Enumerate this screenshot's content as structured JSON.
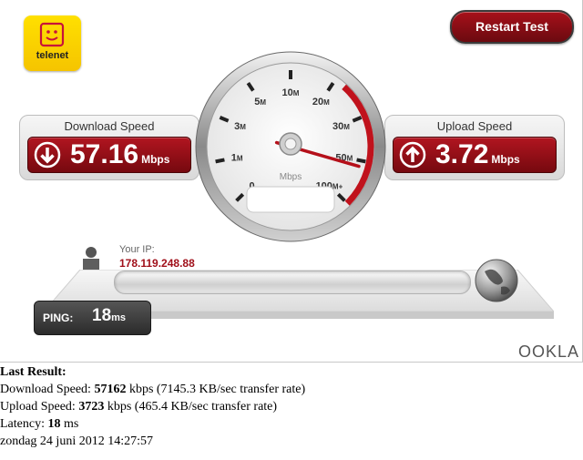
{
  "logo": {
    "text": "telenet",
    "icon": "smiley-face-icon"
  },
  "restart_button": "Restart Test",
  "download": {
    "title": "Download Speed",
    "value": "57.16",
    "unit": "Mbps",
    "icon": "arrow-down-icon"
  },
  "upload": {
    "title": "Upload Speed",
    "value": "3.72",
    "unit": "Mbps",
    "icon": "arrow-up-icon"
  },
  "gauge": {
    "unit_label": "Mbps",
    "ticks": [
      {
        "n": "0",
        "s": ""
      },
      {
        "n": "1",
        "s": "M"
      },
      {
        "n": "3",
        "s": "M"
      },
      {
        "n": "5",
        "s": "M"
      },
      {
        "n": "10",
        "s": "M"
      },
      {
        "n": "20",
        "s": "M"
      },
      {
        "n": "30",
        "s": "M"
      },
      {
        "n": "50",
        "s": "M"
      },
      {
        "n": "100",
        "s": "M+"
      }
    ],
    "needle_value": 57.16,
    "accent": "#c0121c"
  },
  "ip": {
    "label": "Your IP:",
    "value": "178.119.248.88"
  },
  "ping": {
    "label": "PING:",
    "value": "18",
    "unit": "ms"
  },
  "brand": "OOKLA",
  "results": {
    "heading": "Last Result:",
    "download_prefix": "Download Speed: ",
    "download_value": "57162",
    "download_suffix": " kbps (7145.3 KB/sec transfer rate)",
    "upload_prefix": "Upload Speed: ",
    "upload_value": "3723",
    "upload_suffix": " kbps (465.4 KB/sec transfer rate)",
    "latency_prefix": "Latency: ",
    "latency_value": "18",
    "latency_suffix": " ms",
    "date": "zondag 24 juni 2012 14:27:57"
  },
  "colors": {
    "brand_red": "#a0101a",
    "telenet_yellow": "#ffd800"
  }
}
